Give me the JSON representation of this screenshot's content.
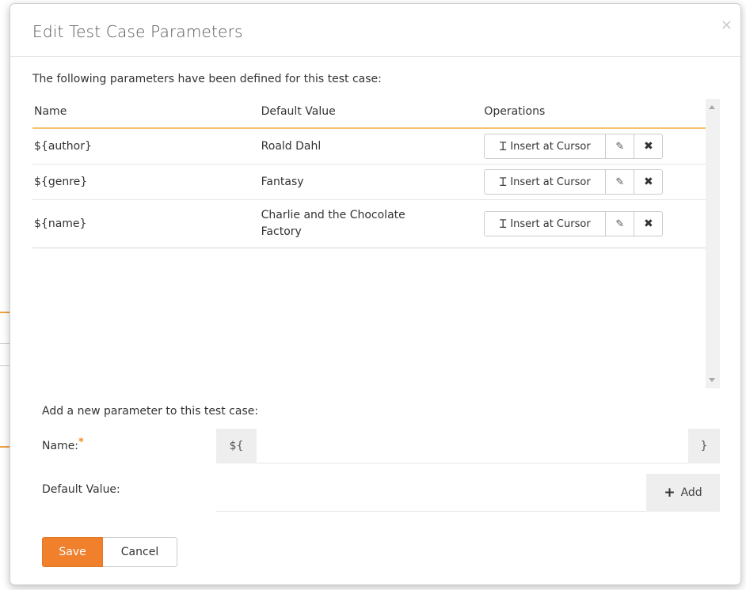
{
  "dialog": {
    "title": "Edit Test Case Parameters",
    "close_glyph": "×"
  },
  "intro_text": "The following parameters have been defined for this test case:",
  "table": {
    "headers": [
      "Name",
      "Default Value",
      "Operations"
    ],
    "rows": [
      {
        "name": "${author}",
        "default_value": "Roald Dahl"
      },
      {
        "name": "${genre}",
        "default_value": "Fantasy"
      },
      {
        "name": "${name}",
        "default_value": "Charlie and the Chocolate Factory"
      }
    ],
    "insert_label": "Insert at Cursor",
    "icons": {
      "insert": "text-cursor-icon",
      "edit": "edit-icon",
      "delete": "delete-icon"
    }
  },
  "add_section": {
    "heading": "Add a new parameter to this test case:",
    "name_label": "Name:",
    "required_marker": "*",
    "name_prefix": "${",
    "name_suffix": "}",
    "name_value": "",
    "default_label": "Default Value:",
    "default_value": "",
    "add_label": "Add"
  },
  "footer": {
    "save_label": "Save",
    "cancel_label": "Cancel"
  },
  "colors": {
    "accent": "#f0802c",
    "header_rule": "#f4c36a"
  }
}
